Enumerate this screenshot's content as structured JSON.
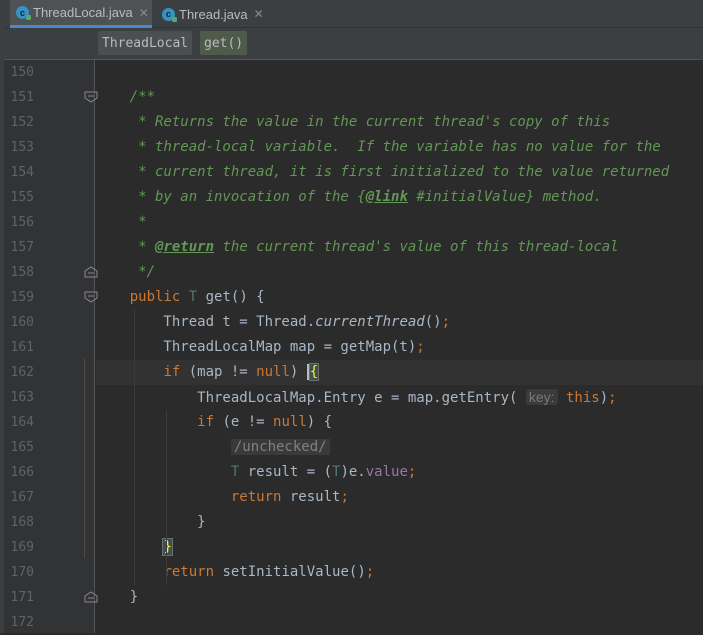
{
  "tabs": [
    {
      "label": "ThreadLocal.java",
      "active": true
    },
    {
      "label": "Thread.java",
      "active": false
    }
  ],
  "tab_close_glyph": "✕",
  "file_icon_letter": "c",
  "breadcrumb": [
    "ThreadLocal",
    "get()"
  ],
  "lines": [
    {
      "num": "150",
      "parts": []
    },
    {
      "num": "151",
      "parts": [
        {
          "t": "    /**",
          "c": "cm"
        }
      ]
    },
    {
      "num": "152",
      "parts": [
        {
          "t": "     * Returns the value in the current thread's copy of this",
          "c": "cm"
        }
      ]
    },
    {
      "num": "153",
      "parts": [
        {
          "t": "     * thread-local variable.  If the variable has no value for the",
          "c": "cm"
        }
      ]
    },
    {
      "num": "154",
      "parts": [
        {
          "t": "     * current thread, it is first initialized to the value returned",
          "c": "cm"
        }
      ]
    },
    {
      "num": "155",
      "parts": [
        {
          "t": "     * by an invocation of the ",
          "c": "cm"
        },
        {
          "t": "{",
          "c": "cm"
        },
        {
          "t": "@link",
          "c": "tag"
        },
        {
          "t": " #initialValue} method.",
          "c": "cm"
        }
      ]
    },
    {
      "num": "156",
      "parts": [
        {
          "t": "     *",
          "c": "cm"
        }
      ]
    },
    {
      "num": "157",
      "parts": [
        {
          "t": "     * ",
          "c": "cm"
        },
        {
          "t": "@return",
          "c": "tag"
        },
        {
          "t": " the current thread's value of this thread-local",
          "c": "cm"
        }
      ]
    },
    {
      "num": "158",
      "parts": [
        {
          "t": "     */",
          "c": "cm"
        }
      ]
    },
    {
      "num": "159",
      "parts": [
        {
          "t": "    "
        },
        {
          "t": "public ",
          "c": "kw"
        },
        {
          "t": "T",
          "c": "tp"
        },
        {
          "t": " get() {"
        }
      ]
    },
    {
      "num": "160",
      "parts": [
        {
          "t": "        Thread t = Thread."
        },
        {
          "t": "currentThread",
          "c": "it"
        },
        {
          "t": "()"
        },
        {
          "t": ";",
          "c": "kw"
        }
      ]
    },
    {
      "num": "161",
      "parts": [
        {
          "t": "        ThreadLocalMap map = getMap(t)"
        },
        {
          "t": ";",
          "c": "kw"
        }
      ]
    },
    {
      "num": "162",
      "current": true,
      "parts": [
        {
          "t": "        "
        },
        {
          "t": "if ",
          "c": "kw"
        },
        {
          "t": "(map != "
        },
        {
          "t": "null",
          "c": "kw"
        },
        {
          "t": ") "
        },
        {
          "t": "CARET",
          "c": "caret"
        },
        {
          "t": "{",
          "c": "brace"
        }
      ]
    },
    {
      "num": "163",
      "parts": [
        {
          "t": "            ThreadLocalMap.Entry e = map.getEntry( "
        },
        {
          "t": "key:",
          "c": "hint"
        },
        {
          "t": " "
        },
        {
          "t": "this",
          "c": "kw"
        },
        {
          "t": ")"
        },
        {
          "t": ";",
          "c": "kw"
        }
      ]
    },
    {
      "num": "164",
      "parts": [
        {
          "t": "            "
        },
        {
          "t": "if ",
          "c": "kw"
        },
        {
          "t": "(e != "
        },
        {
          "t": "null",
          "c": "kw"
        },
        {
          "t": ") {"
        }
      ]
    },
    {
      "num": "165",
      "parts": [
        {
          "t": "                "
        },
        {
          "t": "/unchecked/",
          "c": "fcom"
        }
      ]
    },
    {
      "num": "166",
      "parts": [
        {
          "t": "                "
        },
        {
          "t": "T",
          "c": "tp"
        },
        {
          "t": " result = ("
        },
        {
          "t": "T",
          "c": "tp"
        },
        {
          "t": ")e."
        },
        {
          "t": "value",
          "c": "fld"
        },
        {
          "t": ";",
          "c": "kw"
        }
      ]
    },
    {
      "num": "167",
      "parts": [
        {
          "t": "                "
        },
        {
          "t": "return ",
          "c": "kw"
        },
        {
          "t": "result"
        },
        {
          "t": ";",
          "c": "kw"
        }
      ]
    },
    {
      "num": "168",
      "parts": [
        {
          "t": "            }"
        }
      ]
    },
    {
      "num": "169",
      "parts": [
        {
          "t": "        "
        },
        {
          "t": "}",
          "c": "brace"
        }
      ]
    },
    {
      "num": "170",
      "parts": [
        {
          "t": "        "
        },
        {
          "t": "return ",
          "c": "kw"
        },
        {
          "t": "setInitialValue()"
        },
        {
          "t": ";",
          "c": "kw"
        }
      ]
    },
    {
      "num": "171",
      "parts": [
        {
          "t": "    }"
        }
      ]
    },
    {
      "num": "172",
      "parts": []
    }
  ],
  "folds": {
    "151": "open",
    "158": "end",
    "159": "open",
    "171": "end"
  },
  "colors": {
    "background": "#2b2b2b",
    "keyword": "#cc7832",
    "comment": "#629755",
    "field": "#9876aa",
    "brace_match": "#ffef28"
  }
}
